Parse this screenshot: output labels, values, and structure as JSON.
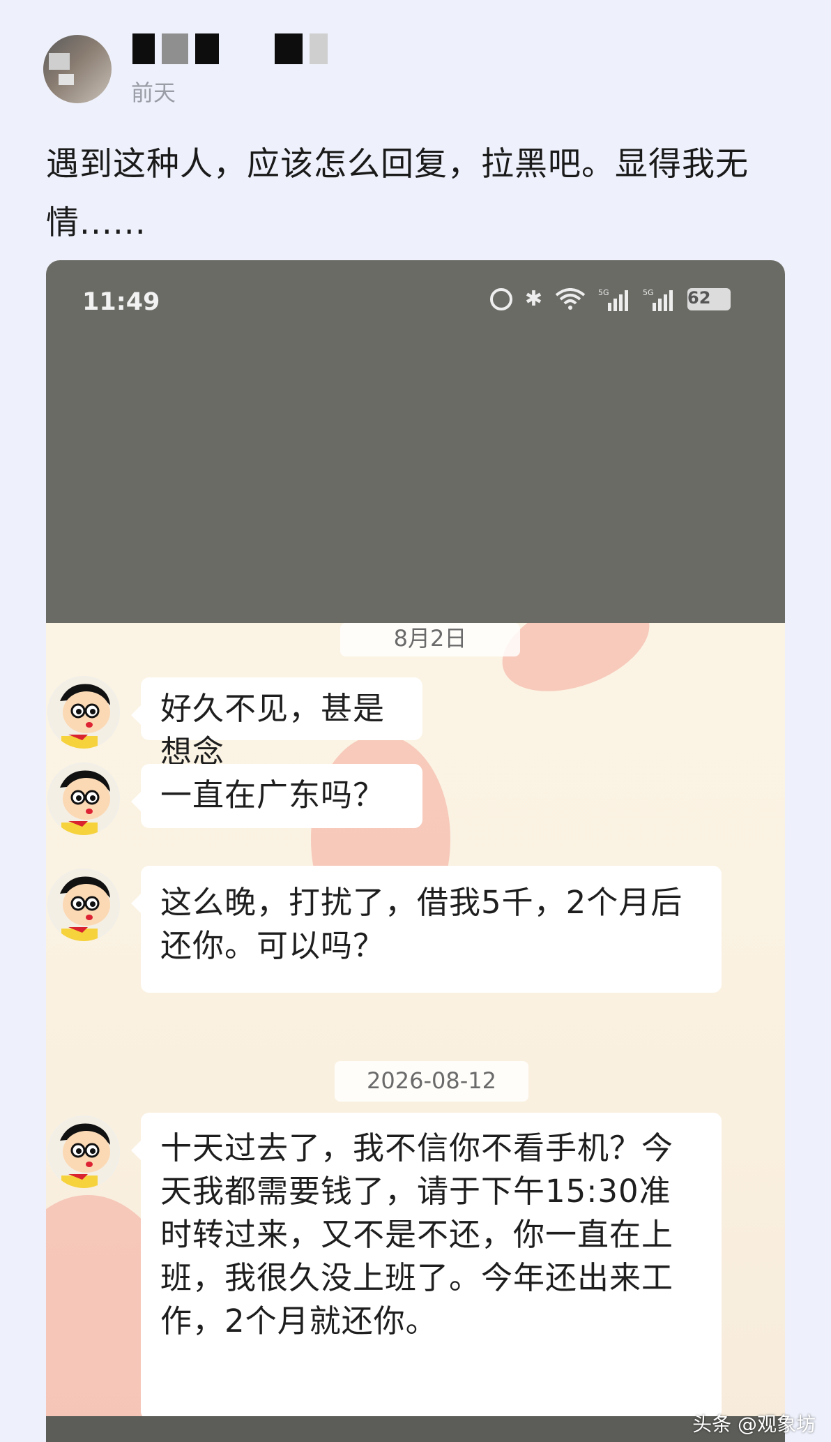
{
  "post": {
    "timestamp": "前天",
    "text": "遇到这种人，应该怎么回复，拉黑吧。显得我无情......"
  },
  "phone": {
    "status_time": "11:49",
    "battery": "62",
    "network_1": "5G",
    "network_2": "5G"
  },
  "chat": {
    "date_1": "8月2日",
    "date_2": "2026-08-12",
    "messages": [
      {
        "text": "好久不见，甚是想念"
      },
      {
        "text": "一直在广东吗？"
      },
      {
        "text": "这么晚，打扰了，借我5千，2个月后还你。可以吗？"
      },
      {
        "text": "十天过去了，我不信你不看手机？今天我都需要钱了，请于下午15:30准时转过来，又不是不还，你一直在上班，我很久没上班了。今年还出来工作，2个月就还你。"
      }
    ]
  },
  "watermark": "头条 @观象坊"
}
